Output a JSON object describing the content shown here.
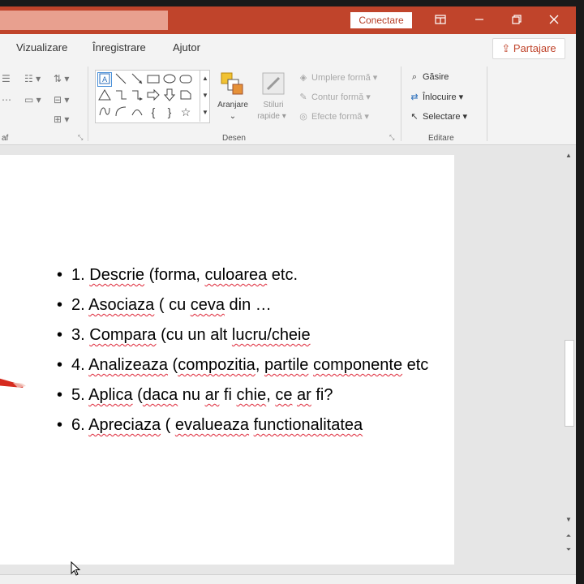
{
  "titlebar": {
    "connect_label": "Conectare",
    "buttons": [
      "ribbon-display-icon",
      "minimize-icon",
      "restore-icon",
      "close-icon"
    ]
  },
  "tabs": {
    "items": [
      "Vizualizare",
      "Înregistrare",
      "Ajutor"
    ],
    "share_label": "Partajare"
  },
  "ribbon": {
    "groups": {
      "paragraph_label": "af",
      "drawing_label": "Desen",
      "editing_label": "Editare"
    },
    "drawing": {
      "arrange_label": "Aranjare",
      "quick_styles_label": "Stiluri",
      "quick_styles_label2": "rapide",
      "shape_fill": "Umplere formă",
      "shape_outline": "Contur formă",
      "shape_effects": "Efecte formă"
    },
    "editing": {
      "find": "Găsire",
      "replace": "Înlocuire",
      "select": "Selectare"
    }
  },
  "slide": {
    "bullets": [
      [
        "1. ",
        "Descrie",
        " (forma, ",
        "culoarea",
        " etc."
      ],
      [
        "2. ",
        "Asociaza",
        " ( cu ",
        "ceva",
        " din …"
      ],
      [
        "3. ",
        "Compara",
        " (cu un alt ",
        "lucru/cheie"
      ],
      [
        "4. ",
        "Analizeaza",
        " (",
        "compozitia",
        ", ",
        "partile",
        " ",
        "componente",
        " etc"
      ],
      [
        "5. ",
        "Aplica",
        " (",
        "daca",
        " nu ",
        "ar",
        " fi ",
        "chie",
        ", ",
        "ce",
        " ",
        "ar",
        " fi?"
      ],
      [
        "6. ",
        "Apreciaza",
        " ( ",
        "evalueaza",
        " ",
        "functionalitatea"
      ]
    ]
  },
  "colors": {
    "titlebar": "#c0442b",
    "spell_underline": "#dd2233"
  }
}
